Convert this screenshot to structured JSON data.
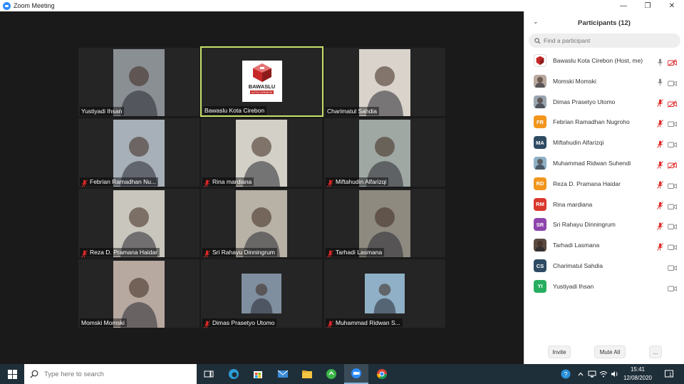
{
  "window": {
    "title": "Zoom Meeting",
    "minimize": "—",
    "maximize": "❐",
    "close": "✕"
  },
  "tiles": [
    {
      "name": "Yustiyadi Ihsan",
      "muted": false,
      "photo": "#8a8f94"
    },
    {
      "name": "Bawaslu Kota Cirebon",
      "muted": false,
      "active": true,
      "logo": true
    },
    {
      "name": "Charimatul Sahdia",
      "muted": false,
      "photo": "#d9d3cc"
    },
    {
      "name": "Febrian Ramadhan Nu...",
      "muted": true,
      "photo": "#a7b0b8"
    },
    {
      "name": "Rina mardiana",
      "muted": true,
      "photo": "#d3d0c8"
    },
    {
      "name": "Miftahudin Alfarizqi",
      "muted": true,
      "photo": "#9fa8a3"
    },
    {
      "name": "Reza D. Pramana Haidar",
      "muted": true,
      "photo": "#c9c6bd"
    },
    {
      "name": "Sri Rahayu Dinningrum",
      "muted": true,
      "photo": "#b8b2a6"
    },
    {
      "name": "Tarhadi Lasmana",
      "muted": true,
      "photo": "#8f8a80"
    },
    {
      "name": "Momski Momski",
      "muted": false,
      "photo": "#b7a8a0"
    },
    {
      "name": "Dimas Prasetyo Utomo",
      "muted": true,
      "photo": "#7f8fa0"
    },
    {
      "name": "Muhammad Ridwan S...",
      "muted": true,
      "photo": "#8fb0c6"
    }
  ],
  "logo": {
    "brand": "BAWASLU",
    "sub": "KOTA CIREBON"
  },
  "panel": {
    "collapse_icon": "⌄",
    "title": "Participants (12)",
    "search_placeholder": "Find a participant",
    "participants": [
      {
        "name": "Bawaslu Kota Cirebon (Host, me)",
        "initials": "",
        "avatar_color": "#ffffff",
        "mic": "on",
        "cam": "off"
      },
      {
        "name": "Momski Momski",
        "initials": "",
        "avatar_color": "#b7a8a0",
        "mic": "on",
        "cam": "on"
      },
      {
        "name": "Dimas Prasetyo Utomo",
        "initials": "",
        "avatar_color": "#9aa5b0",
        "mic": "off",
        "cam": "off"
      },
      {
        "name": "Febrian Ramadhan Nugroho",
        "initials": "FR",
        "avatar_color": "#f2961e",
        "mic": "off",
        "cam": "on"
      },
      {
        "name": "Miftahudin Alfarizqi",
        "initials": "MA",
        "avatar_color": "#2f4b63",
        "mic": "off",
        "cam": "on"
      },
      {
        "name": "Muhammad Ridwan Suhendi",
        "initials": "",
        "avatar_color": "#8fb0c6",
        "mic": "off",
        "cam": "off"
      },
      {
        "name": "Reza D. Pramana Haidar",
        "initials": "RD",
        "avatar_color": "#f2961e",
        "mic": "off",
        "cam": "on"
      },
      {
        "name": "Rina mardiana",
        "initials": "RM",
        "avatar_color": "#d9382c",
        "mic": "off",
        "cam": "on"
      },
      {
        "name": "Sri Rahayu Dinningrum",
        "initials": "SR",
        "avatar_color": "#8e44ad",
        "mic": "off",
        "cam": "on"
      },
      {
        "name": "Tarhadi Lasmana",
        "initials": "",
        "avatar_color": "#5a4a40",
        "mic": "off",
        "cam": "on"
      },
      {
        "name": "Charimatul Sahdia",
        "initials": "CS",
        "avatar_color": "#2f4b63",
        "mic": "none",
        "cam": "on"
      },
      {
        "name": "Yustiyadi Ihsan",
        "initials": "YI",
        "avatar_color": "#27ae60",
        "mic": "none",
        "cam": "on"
      }
    ],
    "invite_label": "Invite",
    "mute_all_label": "Mute All",
    "more_label": "..."
  },
  "taskbar": {
    "search_placeholder": "Type here to search",
    "time": "15:41",
    "date": "12/08/2020",
    "notification_count": "1"
  },
  "colors": {
    "accent": "#2d8cff",
    "muted_red": "#e02828",
    "active_border": "#c6e06b"
  }
}
